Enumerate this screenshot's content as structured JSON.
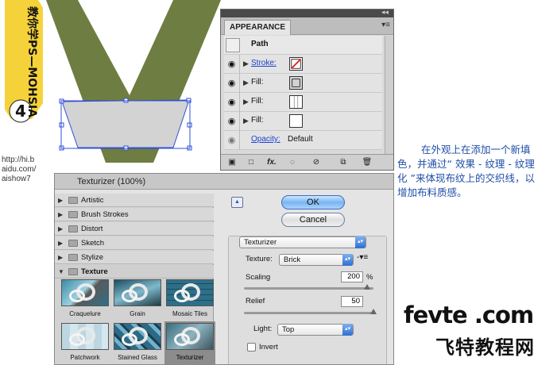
{
  "banner": {
    "text": "教你学PS—MOHSIA",
    "number": "4"
  },
  "watermark_url": [
    "http://hi.b",
    "aidu.com/",
    "aishow7"
  ],
  "appearance_panel": {
    "tab": "APPEARANCE",
    "header_label": "Path",
    "rows": [
      {
        "label": "Stroke:",
        "type": "stroke"
      },
      {
        "label": "Fill:",
        "type": "fill"
      },
      {
        "label": "Fill:",
        "type": "fill-lines"
      },
      {
        "label": "Fill:",
        "type": "fill-white"
      },
      {
        "label": "Opacity:",
        "value": "Default",
        "type": "opacity"
      }
    ],
    "bottom_icons": [
      "new-art-icon",
      "clear-icon",
      "fx-icon",
      "reduce-icon",
      "clear-appearance-icon",
      "duplicate-icon",
      "trash-icon"
    ],
    "fx_label": "fx."
  },
  "description": "在外观上在添加一个新填色，并通过“ 效果 - 纹理 - 纹理化 ”来体现布纹上的交织线，以增加布料质感。",
  "texturizer": {
    "title": "Texturizer (100%)",
    "categories": [
      "Artistic",
      "Brush Strokes",
      "Distort",
      "Sketch",
      "Stylize",
      "Texture"
    ],
    "thumbnails": [
      "Craquelure",
      "Grain",
      "Mosaic Tiles",
      "Patchwork",
      "Stained Glass",
      "Texturizer"
    ],
    "ok_label": "OK",
    "cancel_label": "Cancel",
    "filter_select": "Texturizer",
    "texture_label": "Texture:",
    "texture_value": "Brick",
    "scaling_label": "Scaling",
    "scaling_value": "200",
    "scaling_unit": "%",
    "scaling_level": 0.95,
    "relief_label": "Relief",
    "relief_value": "50",
    "relief_level": 1.0,
    "light_label": "Light:",
    "light_value": "Top",
    "invert_label": "Invert"
  },
  "logo": {
    "en": "fevte .com",
    "cn": "飞特教程网"
  },
  "colors": {
    "olive": "#6e7d41",
    "selection_blue": "#3050d8",
    "desc_blue": "#1f4ea8"
  }
}
